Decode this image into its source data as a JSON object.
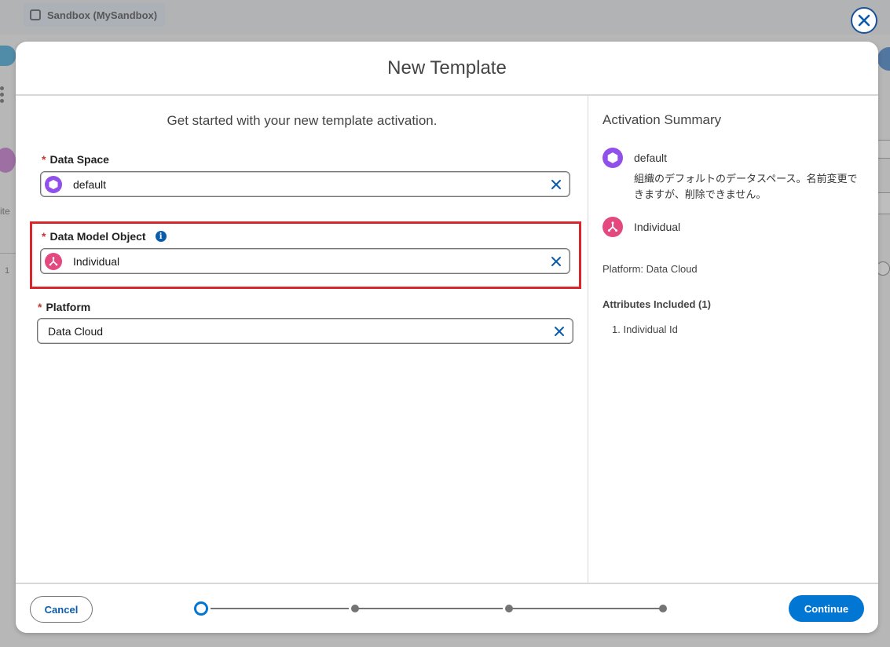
{
  "background": {
    "sandbox_label": "Sandbox (MySandbox)",
    "left_fragment": "ite",
    "row_number": "1"
  },
  "modal": {
    "title": "New Template",
    "subtitle": "Get started with your new template activation.",
    "fields": {
      "data_space": {
        "label": "Data Space",
        "required_mark": "*",
        "value": "default"
      },
      "data_model_object": {
        "label": "Data Model Object",
        "required_mark": "*",
        "value": "Individual",
        "info_glyph": "i"
      },
      "platform": {
        "label": "Platform",
        "required_mark": "*",
        "value": "Data Cloud"
      }
    },
    "summary": {
      "title": "Activation Summary",
      "data_space_name": "default",
      "data_space_description": "組織のデフォルトのデータスペース。名前変更できますが、削除できません。",
      "object_name": "Individual",
      "platform_text": "Platform: Data Cloud",
      "attributes_title": "Attributes Included (1)",
      "attributes": [
        "1. Individual Id"
      ]
    },
    "footer": {
      "cancel_label": "Cancel",
      "continue_label": "Continue",
      "steps_total": 4,
      "current_step": 1
    }
  },
  "colors": {
    "brand_blue": "#0176d3",
    "data_space_icon": "#9050e9",
    "dmo_icon": "#e3487f",
    "highlight": "#d9262b",
    "required": "#c23934"
  },
  "icons": {
    "close": "close-icon",
    "data_space": "hexagon-icon",
    "data_model_object": "individual-object-icon",
    "clear": "clear-x-icon",
    "info": "info-icon"
  }
}
